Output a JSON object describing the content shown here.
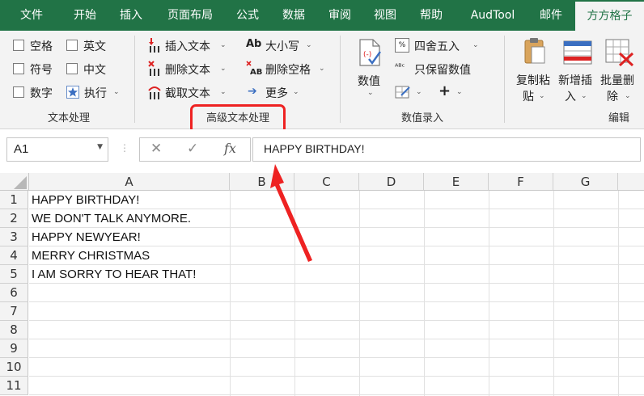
{
  "tabs": [
    "文件",
    "开始",
    "插入",
    "页面布局",
    "公式",
    "数据",
    "审阅",
    "视图",
    "帮助",
    "AudTool",
    "邮件",
    "方方格子"
  ],
  "active_tab": "方方格子",
  "groups": {
    "text_processing": {
      "label": "文本处理",
      "options": [
        "空格",
        "英文",
        "符号",
        "中文",
        "数字",
        "执行"
      ]
    },
    "advanced_text": {
      "label": "高级文本处理",
      "items": [
        "插入文本",
        "删除文本",
        "截取文本",
        "大小写",
        "删除空格",
        "更多"
      ]
    },
    "numeric_entry": {
      "label": "数值录入",
      "big_button": "数值",
      "items": [
        "四舍五入",
        "只保留数值"
      ]
    },
    "edit": {
      "label": "编辑",
      "buttons": [
        {
          "line1": "复制粘",
          "line2": "贴"
        },
        {
          "line1": "新增插",
          "line2": "入"
        },
        {
          "line1": "批量删",
          "line2": "除"
        }
      ]
    }
  },
  "name_box": "A1",
  "formula_value": "HAPPY BIRTHDAY!",
  "formula_icons": [
    "✕",
    "✓",
    "fx"
  ],
  "columns": [
    "A",
    "B",
    "C",
    "D",
    "E",
    "F",
    "G"
  ],
  "rows": [
    "1",
    "2",
    "3",
    "4",
    "5",
    "6",
    "7",
    "8",
    "9",
    "10",
    "11"
  ],
  "cells": [
    "HAPPY BIRTHDAY!",
    "WE DON'T TALK ANYMORE.",
    "HAPPY NEWYEAR!",
    "MERRY CHRISTMAS",
    "I AM SORRY TO HEAR THAT!"
  ],
  "colors": {
    "accent": "#217346",
    "highlight": "#ee2222"
  }
}
